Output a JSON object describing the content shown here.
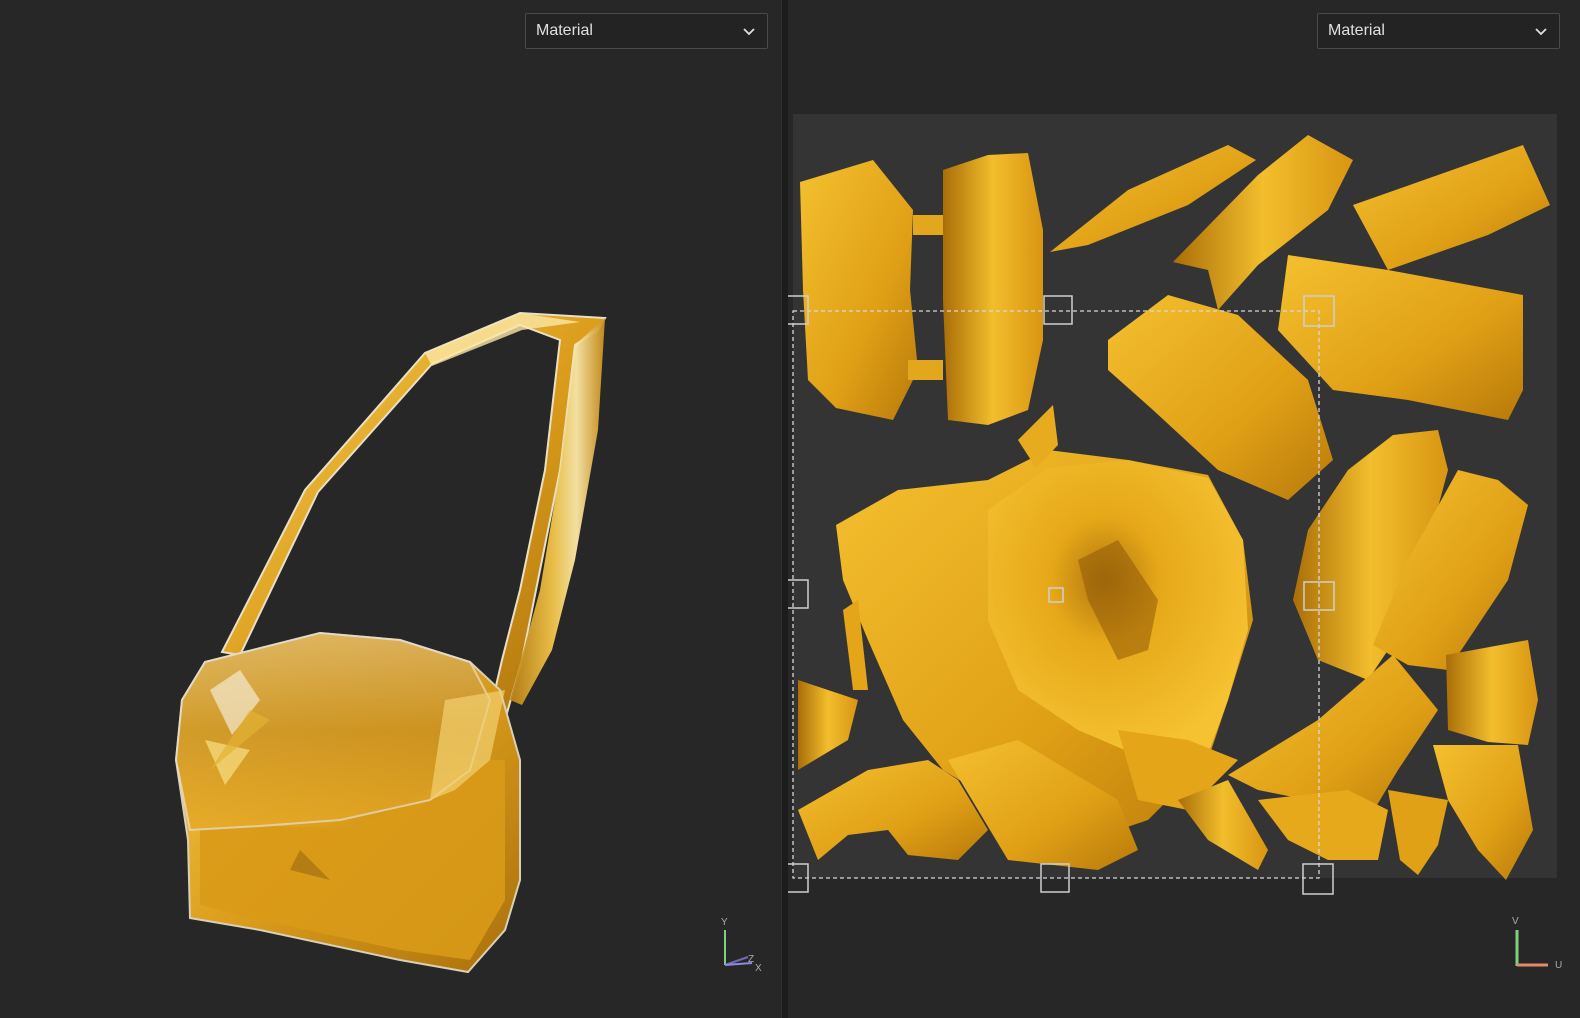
{
  "left_viewport": {
    "shading_mode": "Material",
    "gizmo": {
      "y": "Y",
      "z": "Z",
      "x": "X"
    }
  },
  "right_viewport": {
    "shading_mode": "Material",
    "gizmo": {
      "v": "V",
      "u": "U"
    }
  },
  "colors": {
    "background": "#272727",
    "uv_canvas": "#343434",
    "gold_light": "#f5c23a",
    "gold_mid": "#e3a11c",
    "gold_dark": "#9c6408",
    "selection_dash": "#d8d8d8",
    "axis_y": "#7fcf7f",
    "axis_x": "#e38a6b",
    "axis_z": "#8b8be6"
  },
  "icons": {
    "dropdown": "chevron-down-icon",
    "handle": "transform-handle-square"
  }
}
